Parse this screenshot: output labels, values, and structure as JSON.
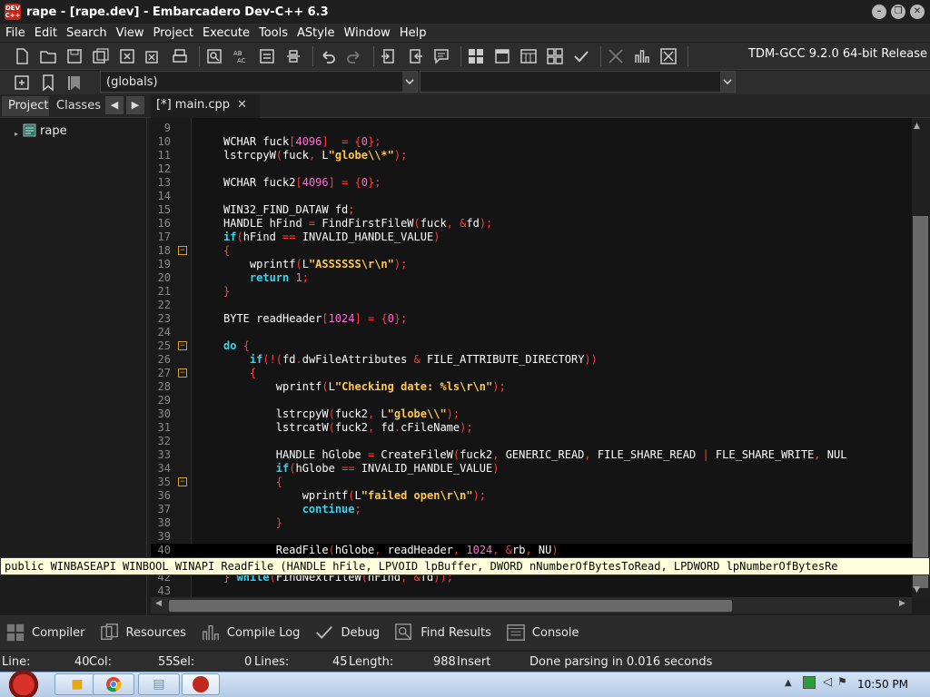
{
  "window": {
    "title": "rape - [rape.dev] - Embarcadero Dev-C++ 6.3",
    "icon_text": "DEV C++"
  },
  "menu": [
    "File",
    "Edit",
    "Search",
    "View",
    "Project",
    "Execute",
    "Tools",
    "AStyle",
    "Window",
    "Help"
  ],
  "toolbar": {
    "compiler": "TDM-GCC 9.2.0 64-bit Release",
    "scope": "(globals)"
  },
  "left_panel": {
    "tabs": [
      "Project",
      "Classes"
    ],
    "tree_root": "rape"
  },
  "editor": {
    "file_tab": "[*] main.cpp",
    "lines": [
      {
        "n": "9",
        "html": ""
      },
      {
        "n": "10",
        "html": "WCHAR fuck<span class=\"sym\">[</span><span class=\"num\">4096</span><span class=\"sym\">]</span>  <span class=\"sym\">=</span> <span class=\"sym\">{</span><span class=\"num\">0</span><span class=\"sym\">};</span>"
      },
      {
        "n": "11",
        "html": "lstrcpyW<span class=\"sym\">(</span>fuck<span class=\"sym\">,</span> L<span class=\"str\">\"globe\\\\*\"</span><span class=\"sym\">);</span>"
      },
      {
        "n": "12",
        "html": ""
      },
      {
        "n": "13",
        "html": "WCHAR fuck2<span class=\"sym\">[</span><span class=\"num\">4096</span><span class=\"sym\">]</span> <span class=\"sym\">=</span> <span class=\"sym\">{</span><span class=\"num\">0</span><span class=\"sym\">};</span>"
      },
      {
        "n": "14",
        "html": ""
      },
      {
        "n": "15",
        "html": "WIN32_FIND_DATAW fd<span class=\"sym\">;</span>"
      },
      {
        "n": "16",
        "html": "HANDLE hFind <span class=\"sym\">=</span> FindFirstFileW<span class=\"sym\">(</span>fuck<span class=\"sym\">,</span> <span class=\"sym\">&amp;</span>fd<span class=\"sym\">);</span>"
      },
      {
        "n": "17",
        "html": "<span class=\"kw\">if</span><span class=\"sym\">(</span>hFind <span class=\"sym\">==</span> INVALID_HANDLE_VALUE<span class=\"sym\">)</span>"
      },
      {
        "n": "18",
        "html": "<span class=\"sym\">{</span>",
        "fold": true
      },
      {
        "n": "19",
        "html": "    wprintf<span class=\"sym\">(</span>L<span class=\"str\">\"ASSSSSS\\r\\n\"</span><span class=\"sym\">);</span>"
      },
      {
        "n": "20",
        "html": "    <span class=\"kw\">return</span> <span class=\"num\">1</span><span class=\"sym\">;</span>"
      },
      {
        "n": "21",
        "html": "<span class=\"sym\">}</span>",
        "fold_end": true
      },
      {
        "n": "22",
        "html": ""
      },
      {
        "n": "23",
        "html": "BYTE readHeader<span class=\"sym\">[</span><span class=\"num\">1024</span><span class=\"sym\">]</span> <span class=\"sym\">=</span> <span class=\"sym\">{</span><span class=\"num\">0</span><span class=\"sym\">};</span>"
      },
      {
        "n": "24",
        "html": ""
      },
      {
        "n": "25",
        "html": "<span class=\"kw\">do</span> <span class=\"sym\">{</span>",
        "fold": true
      },
      {
        "n": "26",
        "html": "    <span class=\"kw\">if</span><span class=\"sym\">(!(</span>fd<span class=\"sym\">.</span>dwFileAttributes <span class=\"sym\">&amp;</span> FILE_ATTRIBUTE_DIRECTORY<span class=\"sym\">))</span>"
      },
      {
        "n": "27",
        "html": "    <span class=\"sym\">{</span>",
        "fold": true
      },
      {
        "n": "28",
        "html": "        wprintf<span class=\"sym\">(</span>L<span class=\"str\">\"Checking date: %ls\\r\\n\"</span><span class=\"sym\">);</span>"
      },
      {
        "n": "29",
        "html": ""
      },
      {
        "n": "30",
        "html": "        lstrcpyW<span class=\"sym\">(</span>fuck2<span class=\"sym\">,</span> L<span class=\"str\">\"globe\\\\\"</span><span class=\"sym\">);</span>"
      },
      {
        "n": "31",
        "html": "        lstrcatW<span class=\"sym\">(</span>fuck2<span class=\"sym\">,</span> fd<span class=\"sym\">.</span>cFileName<span class=\"sym\">);</span>"
      },
      {
        "n": "32",
        "html": ""
      },
      {
        "n": "33",
        "html": "        HANDLE hGlobe <span class=\"sym\">=</span> CreateFileW<span class=\"sym\">(</span>fuck2<span class=\"sym\">,</span> GENERIC_READ<span class=\"sym\">,</span> FILE_SHARE_READ <span class=\"sym\">|</span> FLE_SHARE_WRITE<span class=\"sym\">,</span> NUL"
      },
      {
        "n": "34",
        "html": "        <span class=\"kw\">if</span><span class=\"sym\">(</span>hGlobe <span class=\"sym\">==</span> INVALID_HANDLE_VALUE<span class=\"sym\">)</span>"
      },
      {
        "n": "35",
        "html": "        <span class=\"sym\">{</span>",
        "fold": true
      },
      {
        "n": "36",
        "html": "            wprintf<span class=\"sym\">(</span>L<span class=\"str\">\"failed open\\r\\n\"</span><span class=\"sym\">);</span>"
      },
      {
        "n": "37",
        "html": "            <span class=\"kw\">continue</span><span class=\"sym\">;</span>"
      },
      {
        "n": "38",
        "html": "        <span class=\"sym\">}</span>",
        "fold_end": true
      },
      {
        "n": "39",
        "html": ""
      },
      {
        "n": "40",
        "html": "        ReadFile<span class=\"sym\">(</span>hGlobe<span class=\"sym\">,</span> readHeader<span class=\"sym\">,</span> <span class=\"num\">1024</span><span class=\"sym\">,</span> <span class=\"sym\">&amp;</span>rb<span class=\"sym\">,</span> NU<span class=\"sym\">)</span>",
        "current": true
      },
      {
        "n": "41",
        "html": ""
      },
      {
        "n": "42",
        "html": "<span class=\"sym\">}</span> <span class=\"kw\">while</span><span class=\"sym\">(</span>FindNextFileW<span class=\"sym\">(</span>hFind<span class=\"sym\">,</span> <span class=\"sym\">&amp;</span>fd<span class=\"sym\">));</span>"
      },
      {
        "n": "43",
        "html": ""
      }
    ],
    "tooltip": "public WINBASEAPI WINBOOL WINAPI ReadFile (HANDLE hFile, LPVOID lpBuffer, DWORD nNumberOfBytesToRead, LPDWORD lpNumberOfBytesRe"
  },
  "bottom_tabs": [
    {
      "label": "Compiler",
      "icon": "grid-icon"
    },
    {
      "label": "Resources",
      "icon": "resources-icon"
    },
    {
      "label": "Compile Log",
      "icon": "bar-chart-icon"
    },
    {
      "label": "Debug",
      "icon": "checkmark-icon"
    },
    {
      "label": "Find Results",
      "icon": "find-icon"
    },
    {
      "label": "Console",
      "icon": "console-icon"
    }
  ],
  "status": {
    "line_label": "Line:",
    "line": "40",
    "col_label": "Col:",
    "col": "55",
    "sel_label": "Sel:",
    "sel": "0",
    "lines_label": "Lines:",
    "lines": "45",
    "length_label": "Length:",
    "length": "988",
    "mode": "Insert",
    "message": "Done parsing in 0.016 seconds"
  },
  "taskbar": {
    "clock": "10:50 PM"
  },
  "colors": {
    "keyword": "#3ad3f0",
    "string": "#ffc84f",
    "number": "#ff6bd2",
    "symbol": "#ff3b3b",
    "fold": "#d4a017"
  }
}
